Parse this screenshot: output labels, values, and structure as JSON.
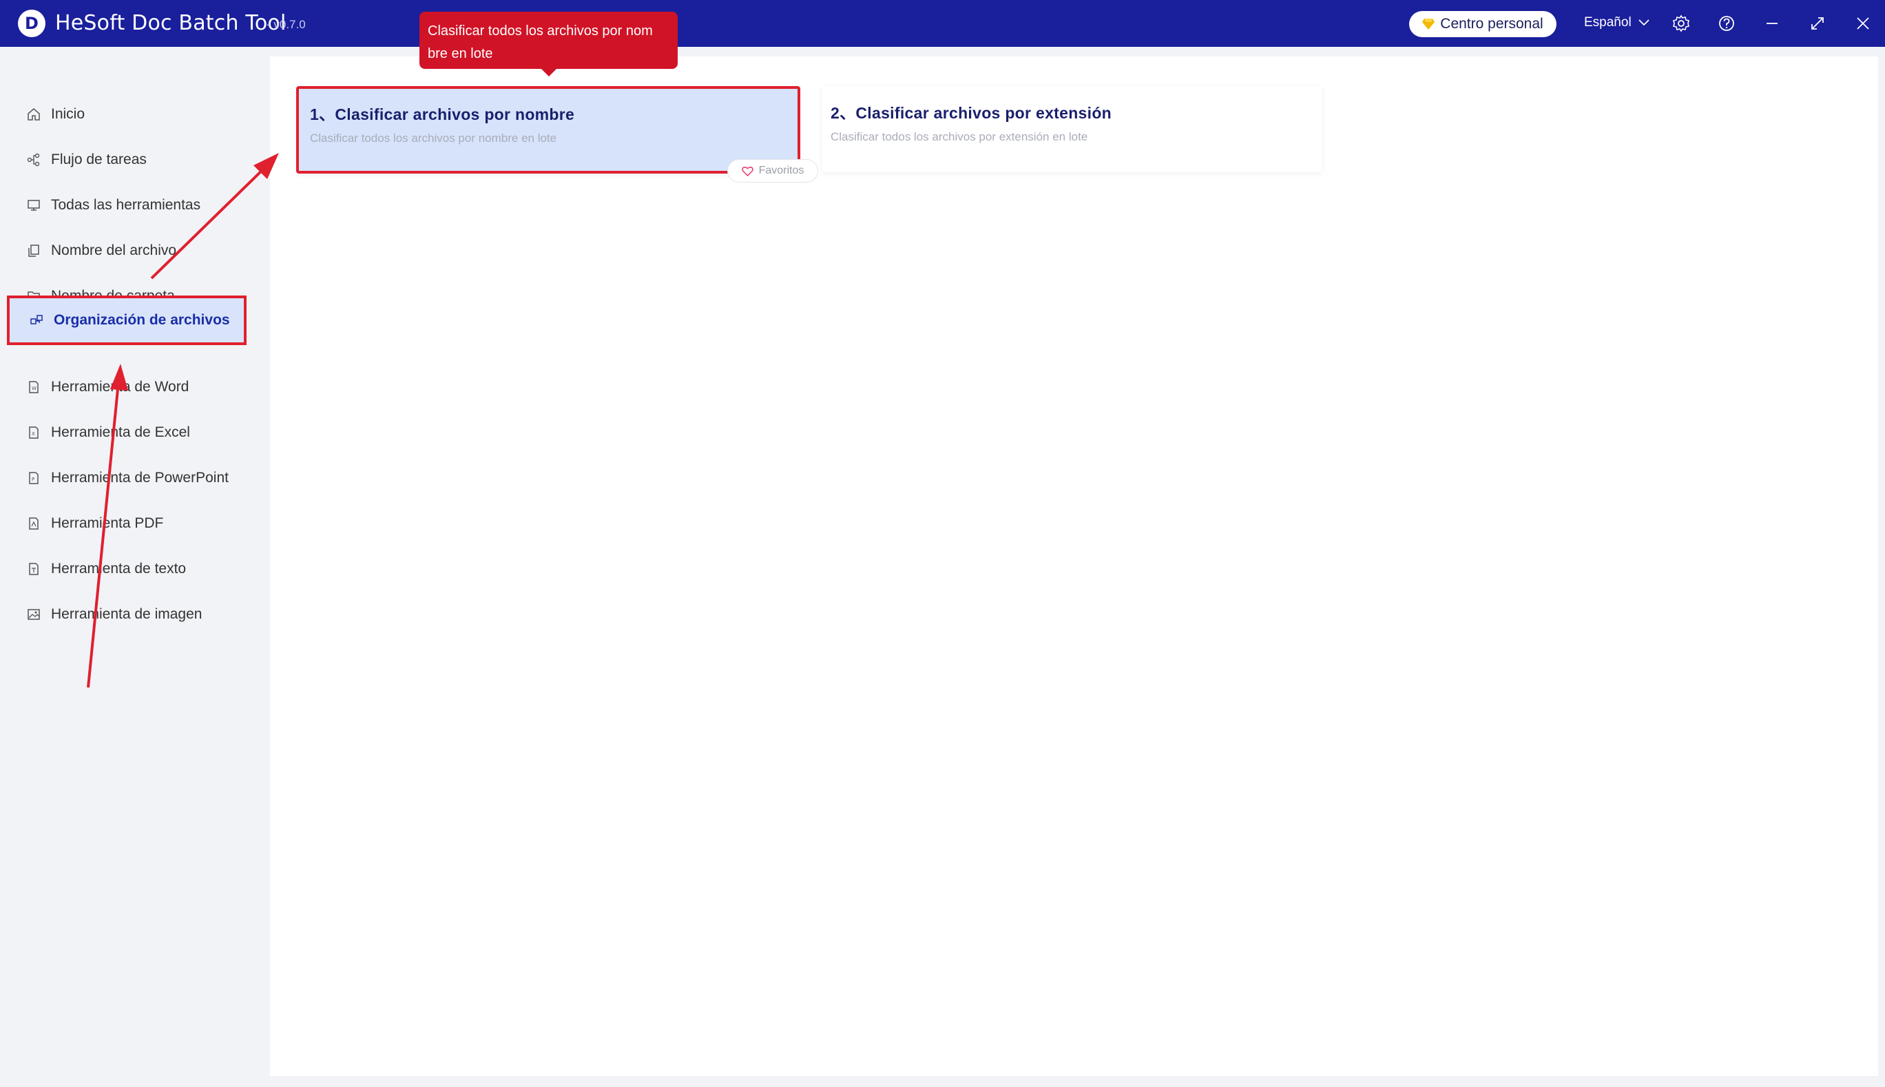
{
  "titlebar": {
    "logo_letter": "D",
    "app_title": "HeSoft Doc Batch Tool",
    "version": "- v0.7.0",
    "personal_center": "Centro personal",
    "language": "Español",
    "icons": [
      "gear-icon",
      "help-icon",
      "minimize-icon",
      "maximize-icon",
      "close-icon"
    ],
    "background_color": "#1a1f9c"
  },
  "sidebar": {
    "items": [
      {
        "label": "Inicio",
        "icon": "home-icon"
      },
      {
        "label": "Flujo de tareas",
        "icon": "workflow-icon"
      },
      {
        "label": "Todas las herramientas",
        "icon": "monitor-icon"
      },
      {
        "label": "Nombre del archivo",
        "icon": "file-copy-icon"
      },
      {
        "label": "Nombre de carpeta",
        "icon": "folder-icon"
      },
      {
        "label": "Organización de archivos",
        "icon": "organize-icon",
        "active": true
      },
      {
        "label": "Herramienta de Word",
        "icon": "word-file-icon"
      },
      {
        "label": "Herramienta de Excel",
        "icon": "excel-file-icon"
      },
      {
        "label": "Herramienta de PowerPoint",
        "icon": "powerpoint-file-icon"
      },
      {
        "label": "Herramienta PDF",
        "icon": "pdf-file-icon"
      },
      {
        "label": "Herramienta de texto",
        "icon": "text-file-icon"
      },
      {
        "label": "Herramienta de imagen",
        "icon": "image-icon"
      }
    ]
  },
  "main": {
    "cards": [
      {
        "title": "1、Clasificar archivos por nombre",
        "desc": "Clasificar todos los archivos por nombre en lote"
      },
      {
        "title": "2、Clasificar archivos por extensión",
        "desc": "Clasificar todos los archivos por extensión en lote"
      }
    ],
    "favorite_label": "Favoritos",
    "tooltip_line1": "Clasificar todos los archivos por nom",
    "tooltip_line2": "bre en lote"
  },
  "colors": {
    "accent": "#1a1f9c",
    "highlight_border": "#e0202e",
    "active_bg": "#d9e4fb",
    "tooltip_bg": "#d01326"
  }
}
